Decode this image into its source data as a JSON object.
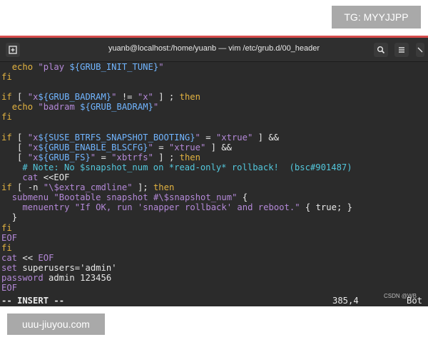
{
  "watermark_top": "TG: MYYJJPP",
  "watermark_bottom": "uuu-jiuyou.com",
  "window_title": "yuanb@localhost:/home/yuanb — vim /etc/grub.d/00_header",
  "status": {
    "mode": "-- INSERT --",
    "position": "385,4",
    "scroll": "Bot",
    "credit": "CSDN @WB"
  },
  "lines": [
    "  echo \"play ${GRUB_INIT_TUNE}\"",
    "fi",
    "",
    "if [ \"x${GRUB_BADRAM}\" != \"x\" ] ; then",
    "  echo \"badram ${GRUB_BADRAM}\"",
    "fi",
    "",
    "if [ \"x${SUSE_BTRFS_SNAPSHOT_BOOTING}\" = \"xtrue\" ] &&",
    "   [ \"x${GRUB_ENABLE_BLSCFG}\" = \"xtrue\" ] &&",
    "   [ \"x${GRUB_FS}\" = \"xbtrfs\" ] ; then",
    "    # Note: No $snapshot_num on *read-only* rollback!  (bsc#901487)",
    "    cat <<EOF",
    "if [ -n \"\\$extra_cmdline\" ]; then",
    "  submenu \"Bootable snapshot #\\$snapshot_num\" {",
    "    menuentry \"If OK, run 'snapper rollback' and reboot.\" { true; }",
    "  }",
    "fi",
    "EOF",
    "fi",
    "cat << EOF",
    "set superusers='admin'",
    "password admin 123456",
    "EOF"
  ]
}
